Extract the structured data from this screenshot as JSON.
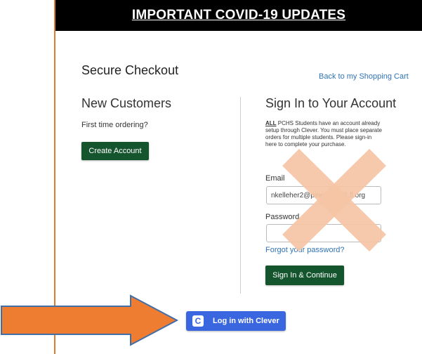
{
  "banner": {
    "text": "IMPORTANT COVID-19 UPDATES"
  },
  "checkout": {
    "title": "Secure Checkout",
    "back_link": "Back to my Shopping Cart"
  },
  "new_customers": {
    "title": "New Customers",
    "subtitle": "First time ordering?",
    "create_button": "Create Account"
  },
  "sign_in": {
    "title": "Sign In to Your Account",
    "info_prefix": "ALL",
    "info_text": " PCHS Students have an account already setup through Clever. You must place separate orders for multiple students. Please sign-in here to complete your purchase.",
    "email_label": "Email",
    "email_value": "nkelleher2@pinellas.k12.fl.org",
    "password_label": "Password",
    "forgot_link": "Forgot your password?",
    "signin_button": "Sign In & Continue"
  },
  "clever": {
    "button_label": "Log in with Clever",
    "logo_letter": "C"
  },
  "colors": {
    "brand_green": "#15552e",
    "link_blue": "#2f74b5",
    "clever_blue": "#3a66e0",
    "annotation_orange": "#e07b2e",
    "cross_peach": "#f6c5a5"
  },
  "annotations": {
    "arrow": "orange-arrow-pointing-right",
    "cross": "peach-x-mark"
  }
}
